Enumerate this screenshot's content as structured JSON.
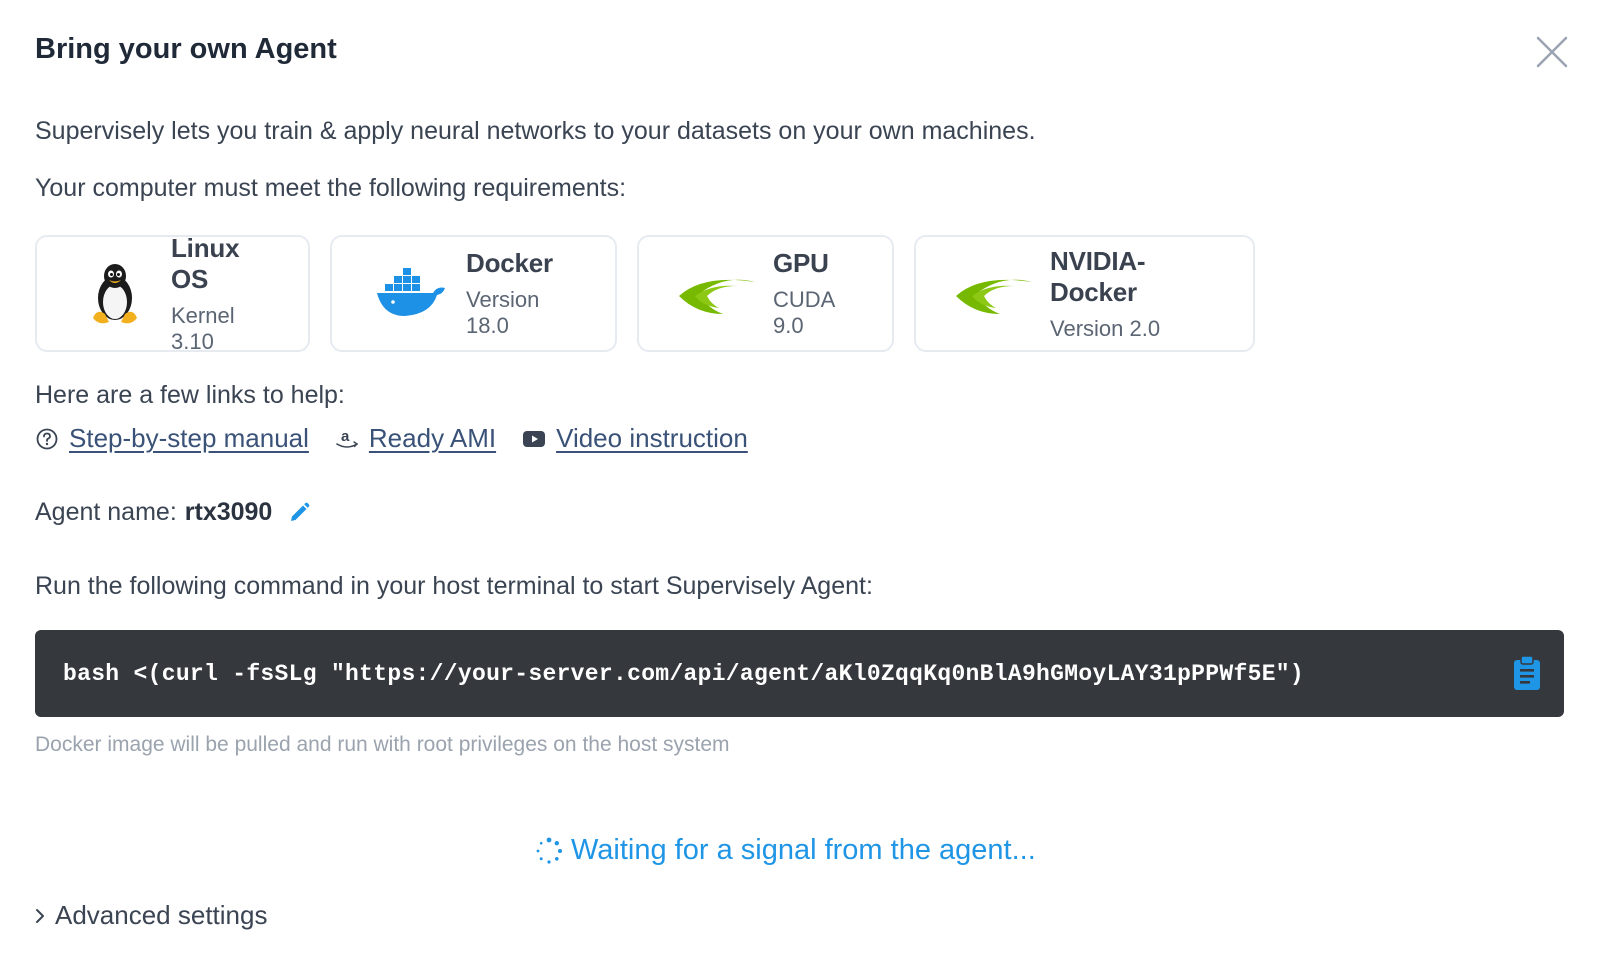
{
  "dialog": {
    "title": "Bring your own Agent",
    "intro": "Supervisely lets you train & apply neural networks to your datasets on your own machines.",
    "requirements_label": "Your computer must meet the following requirements:"
  },
  "requirements": [
    {
      "name": "Linux OS",
      "version": "Kernel 3.10",
      "icon": "linux-penguin-icon"
    },
    {
      "name": "Docker",
      "version": "Version 18.0",
      "icon": "docker-whale-icon"
    },
    {
      "name": "GPU",
      "version": "CUDA 9.0",
      "icon": "nvidia-logo-icon"
    },
    {
      "name": "NVIDIA-Docker",
      "version": "Version 2.0",
      "icon": "nvidia-logo-icon"
    }
  ],
  "links": {
    "label": "Here are a few links to help:",
    "items": [
      {
        "label": "Step-by-step manual",
        "icon": "help-circle-icon"
      },
      {
        "label": "Ready AMI",
        "icon": "amazon-icon"
      },
      {
        "label": "Video instruction",
        "icon": "youtube-icon"
      }
    ]
  },
  "agent": {
    "label": "Agent name:",
    "value": "rtx3090"
  },
  "command": {
    "label": "Run the following command in your host terminal to start Supervisely Agent:",
    "text": "bash <(curl -fsSLg \"https://your-server.com/api/agent/aKl0ZqqKq0nBlA9hGMoyLAY31pPPWf5E\")",
    "note": "Docker image will be pulled and run with root privileges on the host system"
  },
  "status": {
    "waiting_text": "Waiting for a signal from the agent..."
  },
  "advanced": {
    "label": "Advanced settings"
  },
  "colors": {
    "accent": "#1f95e6",
    "nvidia_green": "#76b900",
    "docker_blue": "#1d91e6",
    "command_bg": "#35383d"
  }
}
